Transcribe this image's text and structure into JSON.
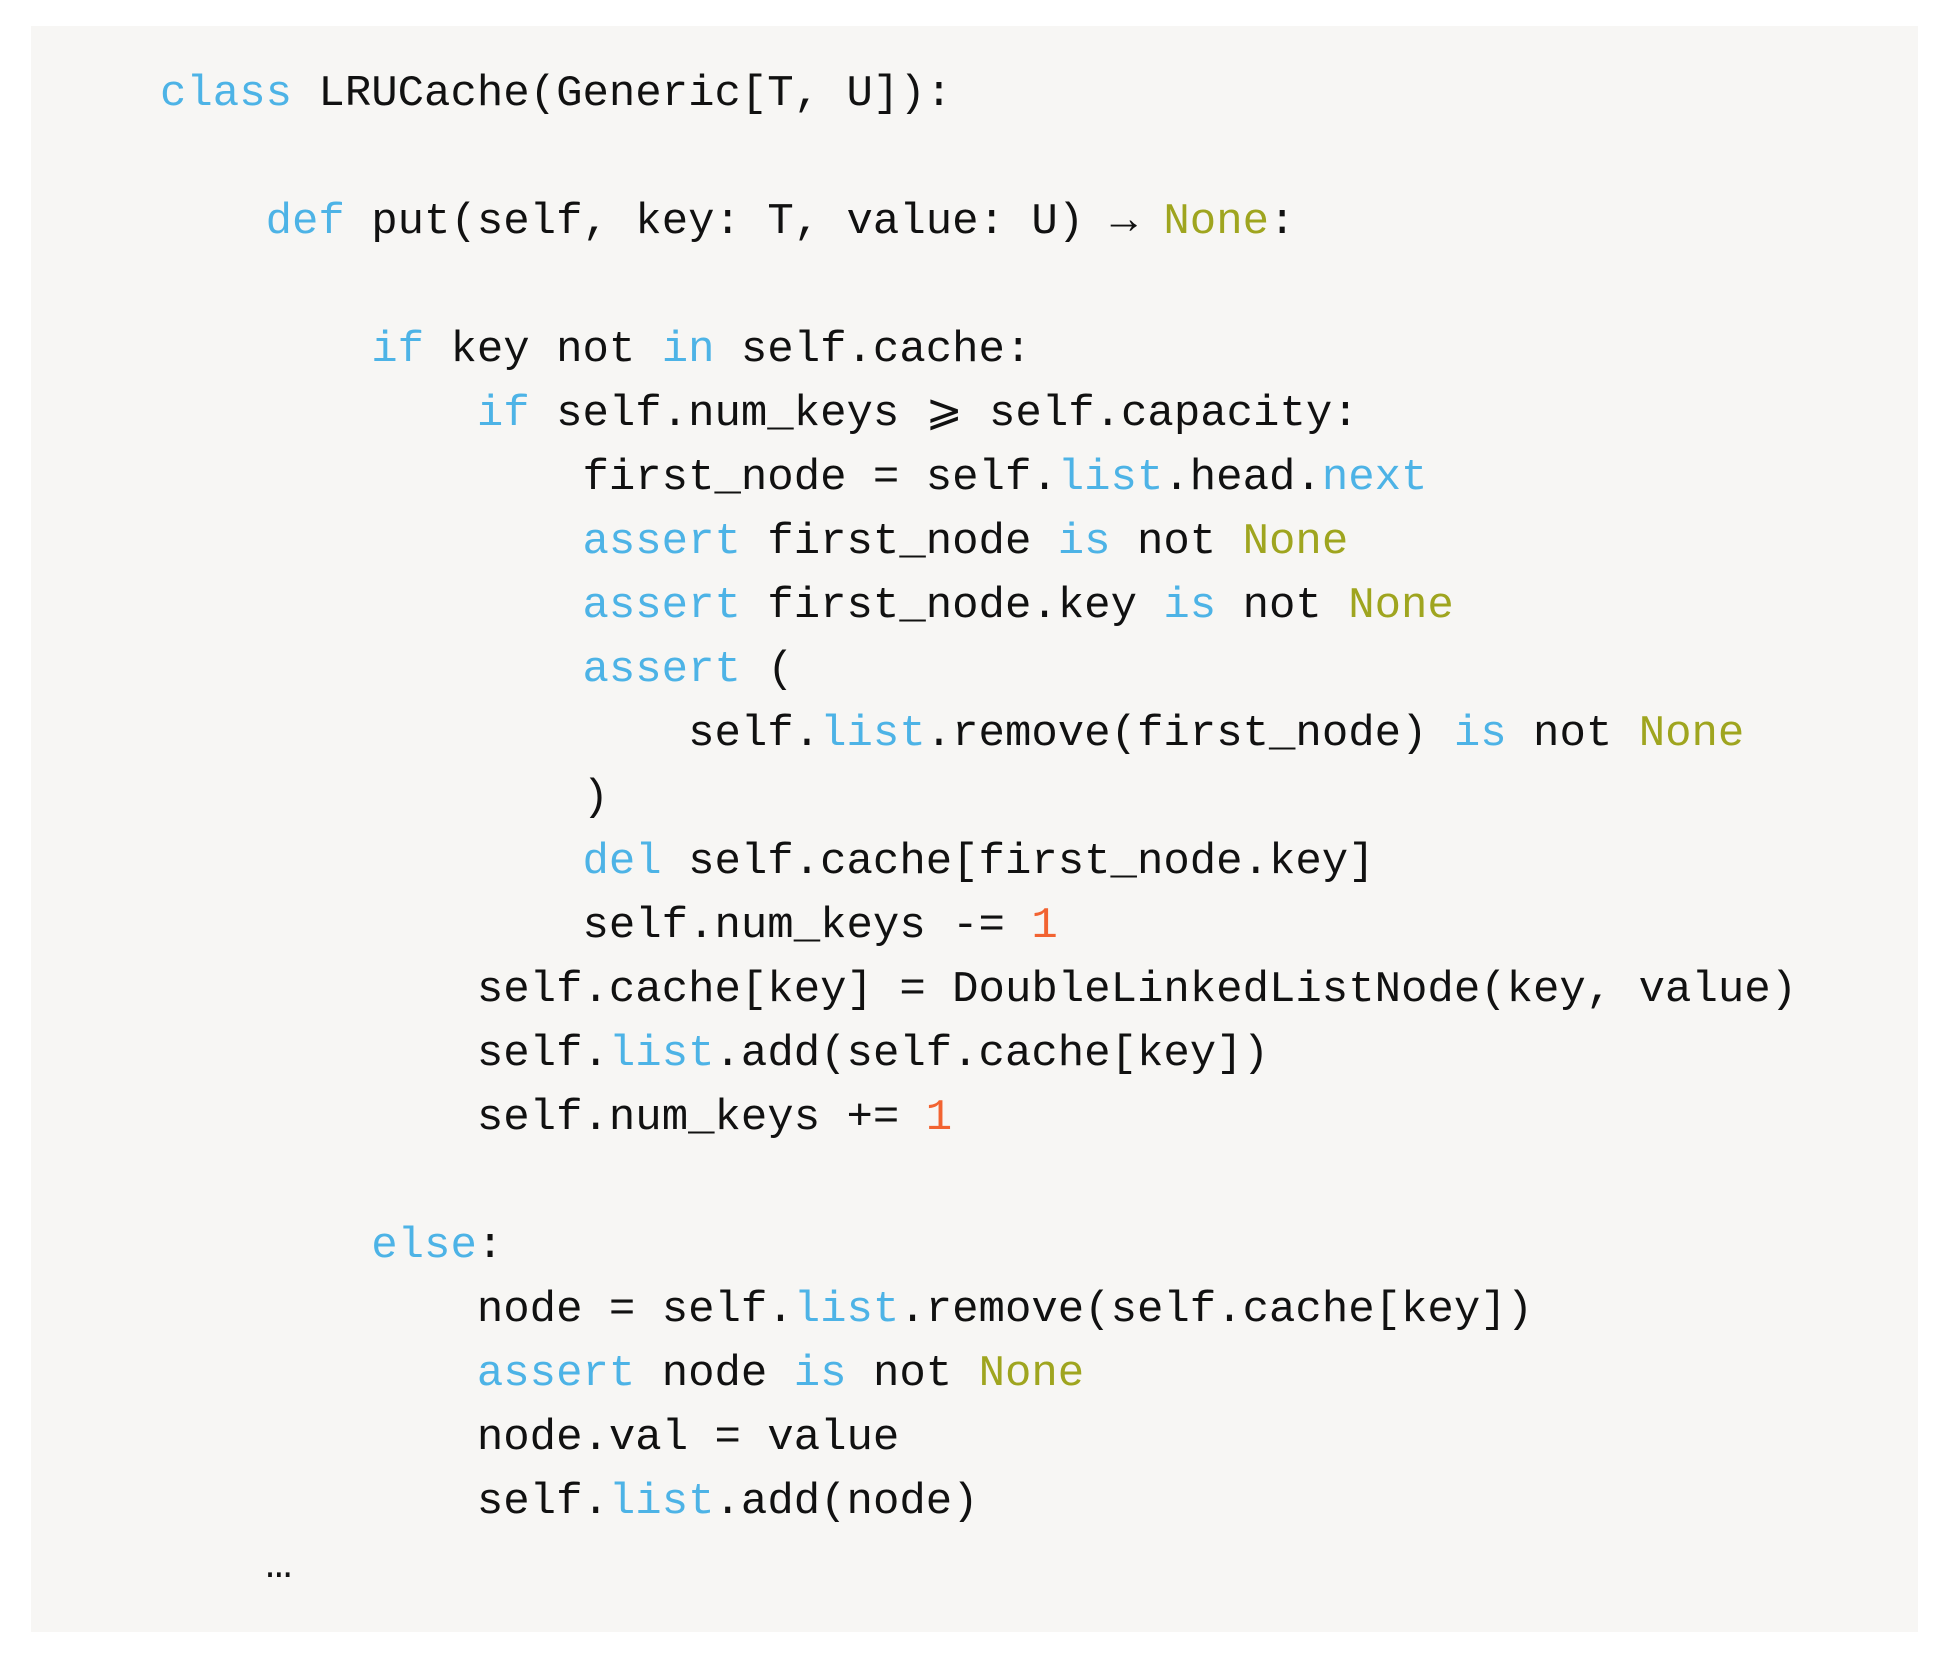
{
  "colors": {
    "background": "#f7f6f4",
    "text": "#111111",
    "keyword": "#4db3e6",
    "constant": "#9fa51f",
    "number": "#f26331"
  },
  "code": {
    "language": "python",
    "lines": [
      {
        "indent": 0,
        "tokens": [
          [
            "kw",
            "class"
          ],
          [
            "plain",
            " LRUCache(Generic[T, U]):"
          ]
        ]
      },
      {
        "indent": 0,
        "tokens": []
      },
      {
        "indent": 4,
        "tokens": [
          [
            "kw",
            "def"
          ],
          [
            "plain",
            " put(self, key: T, value: U) → "
          ],
          [
            "const",
            "None"
          ],
          [
            "plain",
            ":"
          ]
        ]
      },
      {
        "indent": 0,
        "tokens": []
      },
      {
        "indent": 8,
        "tokens": [
          [
            "kw",
            "if"
          ],
          [
            "plain",
            " key not "
          ],
          [
            "kw",
            "in"
          ],
          [
            "plain",
            " self.cache:"
          ]
        ]
      },
      {
        "indent": 12,
        "tokens": [
          [
            "kw",
            "if"
          ],
          [
            "plain",
            " self.num_keys ⩾ self.capacity:"
          ]
        ]
      },
      {
        "indent": 16,
        "tokens": [
          [
            "plain",
            "first_node = self."
          ],
          [
            "kw",
            "list"
          ],
          [
            "plain",
            ".head."
          ],
          [
            "kw",
            "next"
          ]
        ]
      },
      {
        "indent": 16,
        "tokens": [
          [
            "kw",
            "assert"
          ],
          [
            "plain",
            " first_node "
          ],
          [
            "kw",
            "is"
          ],
          [
            "plain",
            " not "
          ],
          [
            "const",
            "None"
          ]
        ]
      },
      {
        "indent": 16,
        "tokens": [
          [
            "kw",
            "assert"
          ],
          [
            "plain",
            " first_node.key "
          ],
          [
            "kw",
            "is"
          ],
          [
            "plain",
            " not "
          ],
          [
            "const",
            "None"
          ]
        ]
      },
      {
        "indent": 16,
        "tokens": [
          [
            "kw",
            "assert"
          ],
          [
            "plain",
            " ("
          ]
        ]
      },
      {
        "indent": 20,
        "tokens": [
          [
            "plain",
            "self."
          ],
          [
            "kw",
            "list"
          ],
          [
            "plain",
            ".remove(first_node) "
          ],
          [
            "kw",
            "is"
          ],
          [
            "plain",
            " not "
          ],
          [
            "const",
            "None"
          ]
        ]
      },
      {
        "indent": 16,
        "tokens": [
          [
            "plain",
            ")"
          ]
        ]
      },
      {
        "indent": 16,
        "tokens": [
          [
            "kw",
            "del"
          ],
          [
            "plain",
            " self.cache[first_node.key]"
          ]
        ]
      },
      {
        "indent": 16,
        "tokens": [
          [
            "plain",
            "self.num_keys -= "
          ],
          [
            "num",
            "1"
          ]
        ]
      },
      {
        "indent": 12,
        "tokens": [
          [
            "plain",
            "self.cache[key] = DoubleLinkedListNode(key, value)"
          ]
        ]
      },
      {
        "indent": 12,
        "tokens": [
          [
            "plain",
            "self."
          ],
          [
            "kw",
            "list"
          ],
          [
            "plain",
            ".add(self.cache[key])"
          ]
        ]
      },
      {
        "indent": 12,
        "tokens": [
          [
            "plain",
            "self.num_keys += "
          ],
          [
            "num",
            "1"
          ]
        ]
      },
      {
        "indent": 0,
        "tokens": []
      },
      {
        "indent": 8,
        "tokens": [
          [
            "kw",
            "else"
          ],
          [
            "plain",
            ":"
          ]
        ]
      },
      {
        "indent": 12,
        "tokens": [
          [
            "plain",
            "node = self."
          ],
          [
            "kw",
            "list"
          ],
          [
            "plain",
            ".remove(self.cache[key])"
          ]
        ]
      },
      {
        "indent": 12,
        "tokens": [
          [
            "kw",
            "assert"
          ],
          [
            "plain",
            " node "
          ],
          [
            "kw",
            "is"
          ],
          [
            "plain",
            " not "
          ],
          [
            "const",
            "None"
          ]
        ]
      },
      {
        "indent": 12,
        "tokens": [
          [
            "plain",
            "node.val = value"
          ]
        ]
      },
      {
        "indent": 12,
        "tokens": [
          [
            "plain",
            "self."
          ],
          [
            "kw",
            "list"
          ],
          [
            "plain",
            ".add(node)"
          ]
        ]
      },
      {
        "indent": 4,
        "tokens": [
          [
            "plain",
            "…"
          ]
        ]
      }
    ]
  }
}
